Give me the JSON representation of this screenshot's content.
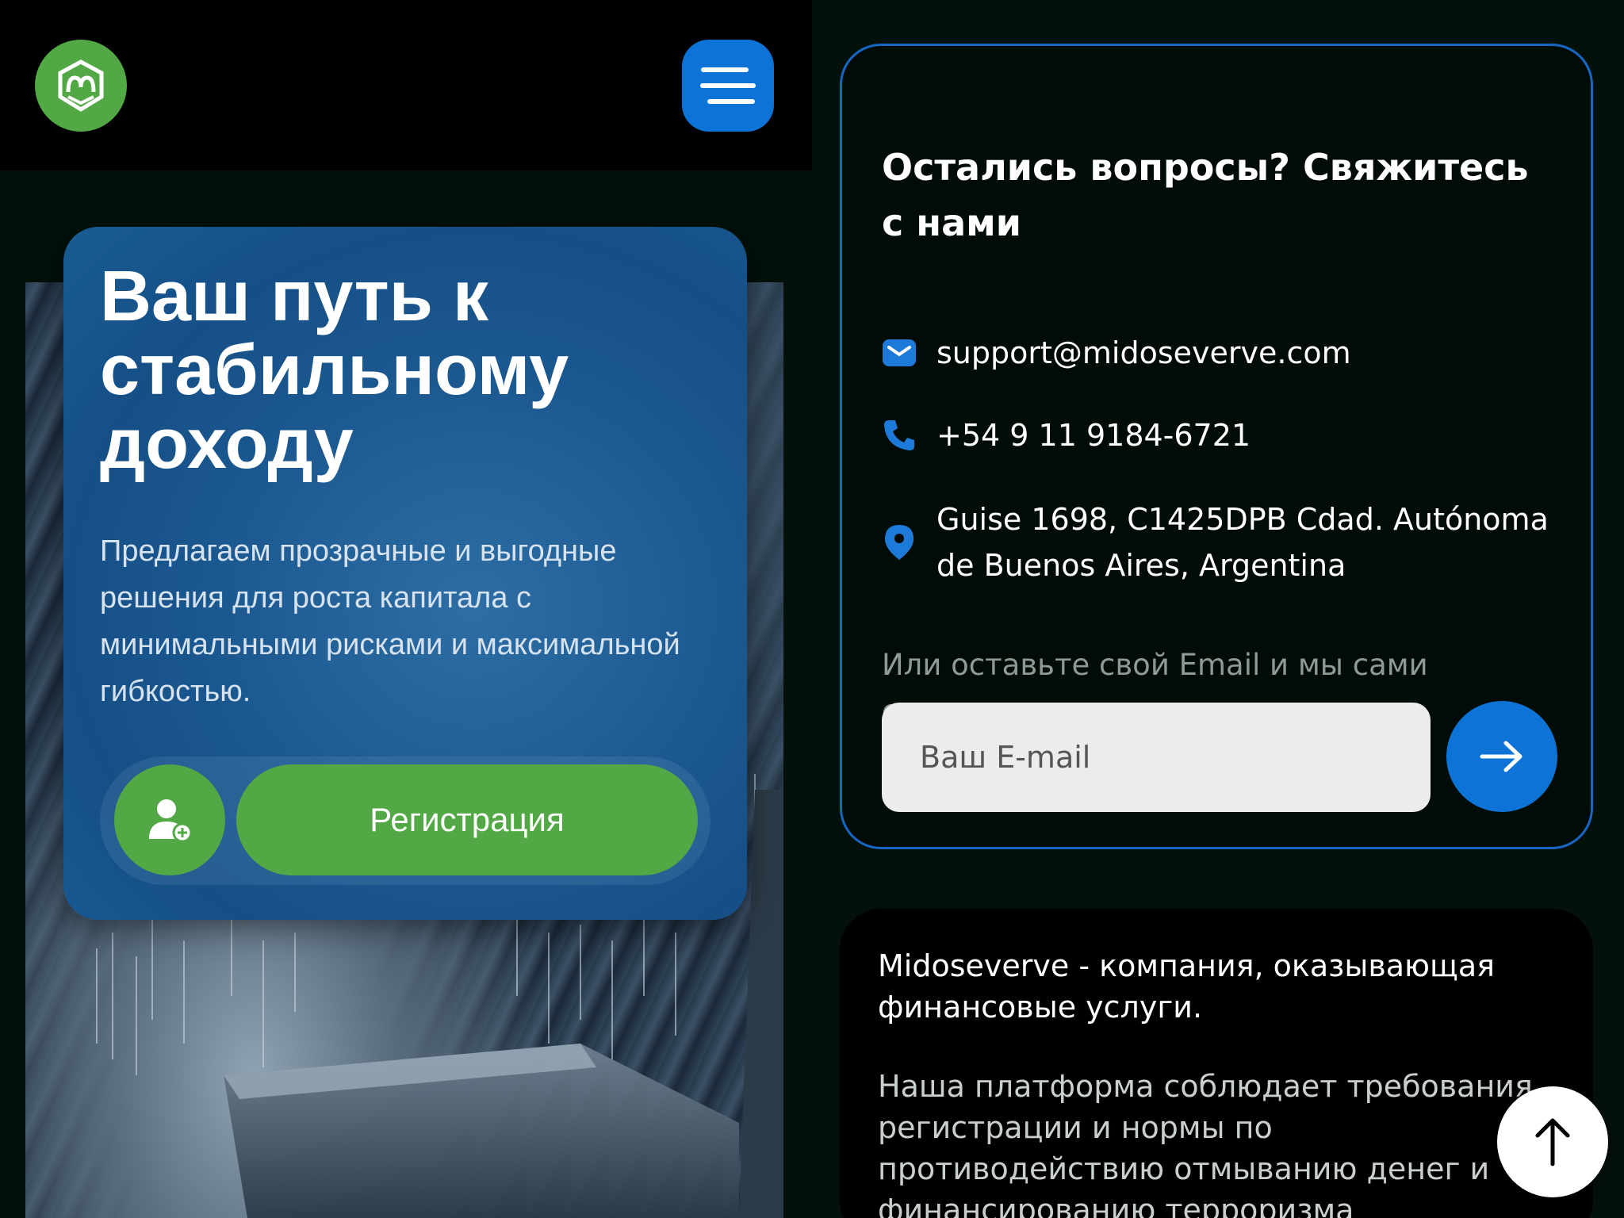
{
  "header": {
    "logo_icon": "brand-logo-icon",
    "menu_icon": "hamburger-menu-icon"
  },
  "hero": {
    "title": "Ваш путь к стабильному доходу",
    "text": "Предлагаем прозрачные и выгодные решения для роста капитала с минимальными рисками и максимальной гибкостью.",
    "register_label": "Регистрация",
    "register_icon": "user-plus-icon"
  },
  "contact": {
    "title": "Остались вопросы? Свяжитесь с нами",
    "email": "support@midoseverve.com",
    "phone": "+54 9 11 9184-6721",
    "address": "Guise 1698, C1425DPB Cdad. Autónoma de Buenos Aires, Argentina",
    "hint": "Или оставьте свой Email и мы сами свяжемся с вами",
    "email_placeholder": "Ваш E-mail"
  },
  "about": {
    "title": "Midoseverve - компания, оказывающая финансовые услуги.",
    "text": "Наша платформа соблюдает требования регистрации и нормы по противодействию отмыванию денег и финансированию терроризма"
  },
  "colors": {
    "accent_blue": "#0d73d6",
    "accent_green": "#52a844",
    "background": "#04110a"
  }
}
